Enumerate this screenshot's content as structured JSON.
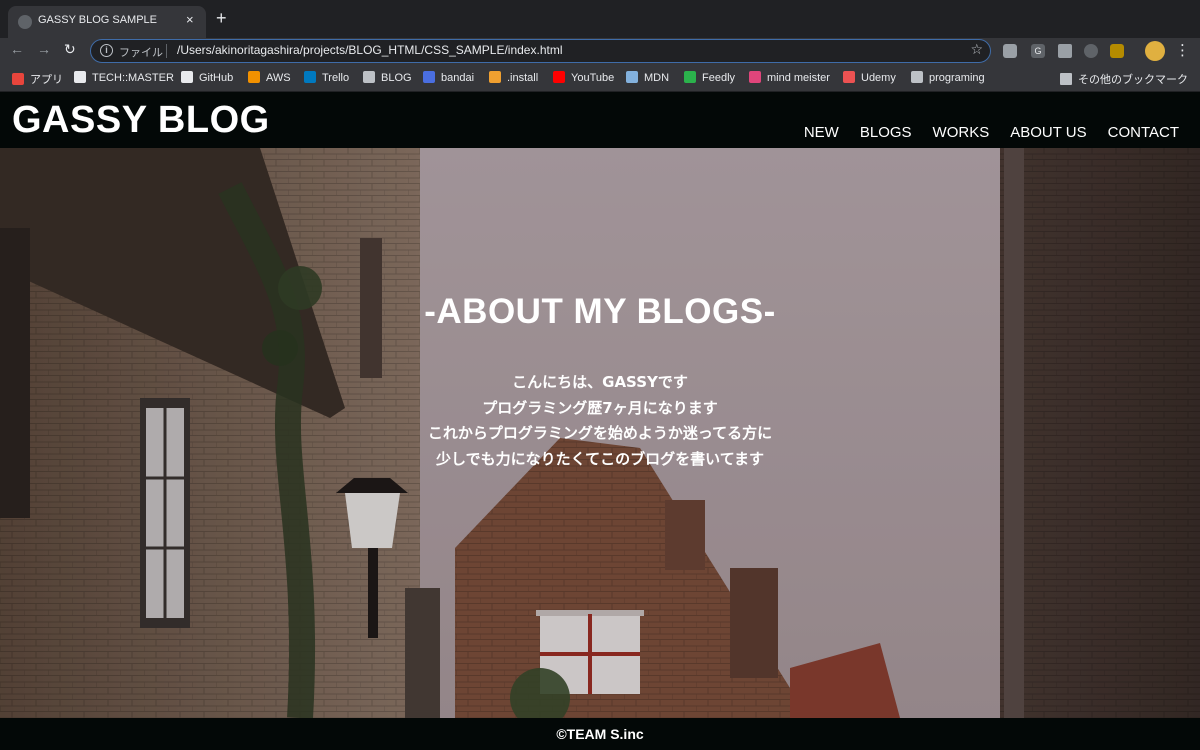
{
  "browser": {
    "tab_title": "GASSY BLOG SAMPLE",
    "tab_close": "×",
    "new_tab": "+",
    "nav": {
      "back": "←",
      "forward": "→",
      "reload": "↻"
    },
    "omnibox": {
      "info": "i",
      "scheme_label": "ファイル",
      "url": "/Users/akinoritagashira/projects/BLOG_HTML/CSS_SAMPLE/index.html",
      "star": "☆"
    },
    "extension_badge": "G",
    "menu": "⋮",
    "bookmarks": [
      {
        "label": "アプリ",
        "icon": "apps-grid-icon",
        "color": "#e8453c"
      },
      {
        "label": "TECH::MASTER",
        "icon": "techmaster-icon",
        "color": "#e8eaed"
      },
      {
        "label": "GitHub",
        "icon": "github-icon",
        "color": "#e8eaed"
      },
      {
        "label": "AWS",
        "icon": "aws-icon",
        "color": "#f29100"
      },
      {
        "label": "Trello",
        "icon": "trello-icon",
        "color": "#0079bf"
      },
      {
        "label": "BLOG",
        "icon": "blog-icon",
        "color": "#bdc1c6"
      },
      {
        "label": "bandai",
        "icon": "bandai-icon",
        "color": "#4a6ee0"
      },
      {
        "label": ".install",
        "icon": "install-icon",
        "color": "#f0a030"
      },
      {
        "label": "YouTube",
        "icon": "youtube-icon",
        "color": "#ff0000"
      },
      {
        "label": "MDN",
        "icon": "mdn-icon",
        "color": "#83b1dd"
      },
      {
        "label": "Feedly",
        "icon": "feedly-icon",
        "color": "#2bb24c"
      },
      {
        "label": "mind meister",
        "icon": "mindmeister-icon",
        "color": "#e0457b"
      },
      {
        "label": "Udemy",
        "icon": "udemy-icon",
        "color": "#ec5252"
      },
      {
        "label": "programing",
        "icon": "folder-icon",
        "color": "#bdc1c6"
      }
    ],
    "other_bookmarks": "その他のブックマーク"
  },
  "site": {
    "logo": "GASSY BLOG",
    "nav": [
      "NEW",
      "BLOGS",
      "WORKS",
      "ABOUT US",
      "CONTACT"
    ],
    "hero": {
      "title": "-ABOUT MY BLOGS-",
      "lines": [
        "こんにちは、GASSYです",
        "プログラミング歴7ヶ月になります",
        "これからプログラミングを始めようか迷ってる方に",
        "少しでも力になりたくてこのブログを書いてます"
      ]
    },
    "footer": "©TEAM S.inc"
  }
}
